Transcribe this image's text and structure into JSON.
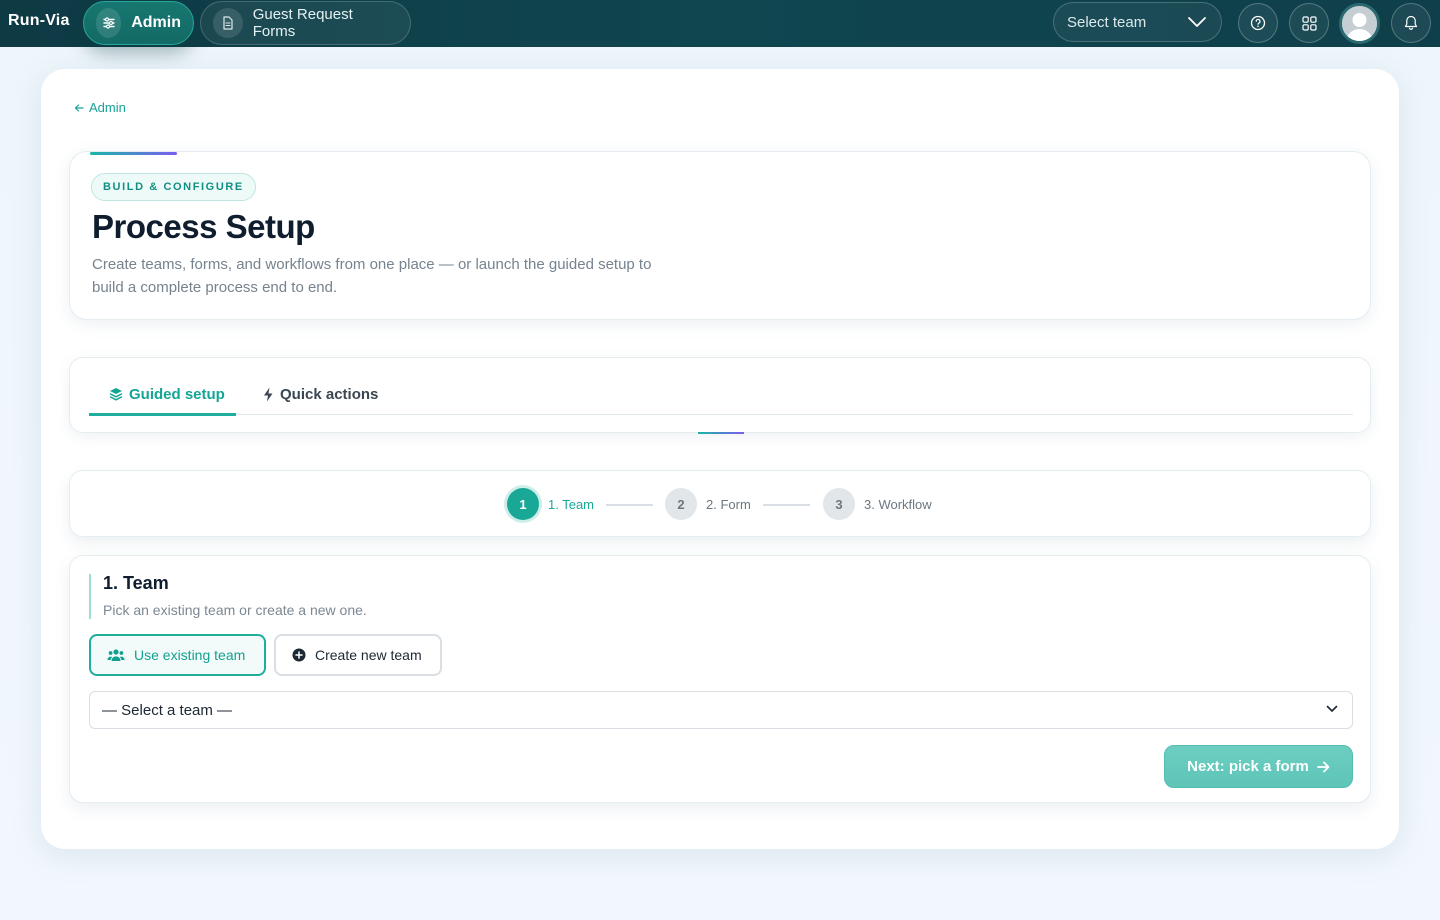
{
  "topbar": {
    "brand": "Run-Via",
    "nav": [
      {
        "label": "Admin",
        "icon": "sliders-icon",
        "active": true
      },
      {
        "label": "Guest Request Forms",
        "icon": "document-icon",
        "active": false
      }
    ],
    "team_select": {
      "value": "Select team"
    },
    "icons": [
      "help-icon",
      "apps-grid-icon",
      "avatar",
      "bell-icon"
    ]
  },
  "back_link": "Admin",
  "header": {
    "badge": "BUILD & CONFIGURE",
    "title": "Process Setup",
    "description": "Create teams, forms, and workflows from one place — or launch the guided setup to build a complete process end to end."
  },
  "tabs": [
    {
      "label": "Guided setup",
      "icon": "layers-icon",
      "active": true
    },
    {
      "label": "Quick actions",
      "icon": "bolt-icon",
      "active": false
    }
  ],
  "stepper": [
    {
      "num": "1",
      "label": "1. Team",
      "active": true
    },
    {
      "num": "2",
      "label": "2. Form",
      "active": false
    },
    {
      "num": "3",
      "label": "3. Workflow",
      "active": false
    }
  ],
  "team_section": {
    "title": "1. Team",
    "subtitle": "Pick an existing team or create a new one.",
    "use_existing": "Use existing team",
    "create_new": "Create new team",
    "select_placeholder": "— Select a team —",
    "next": "Next: pick a form"
  },
  "colors": {
    "topbar": "#0f4650",
    "accent": "#19a896",
    "accent_gradient_end": "#7b5cf0",
    "next_button": "#6ccec1"
  }
}
